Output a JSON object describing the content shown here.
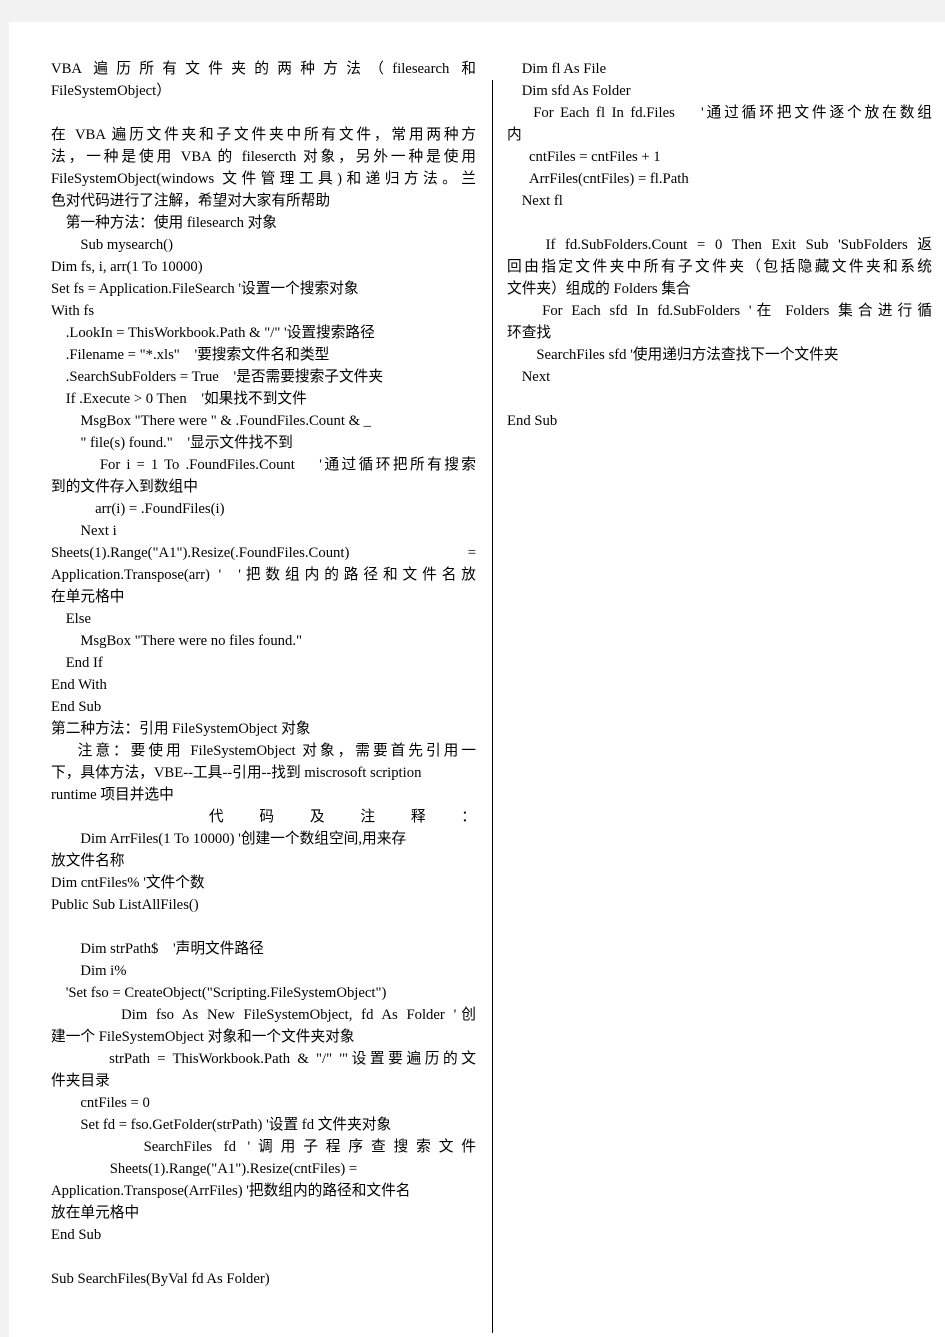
{
  "document": {
    "title": "VBA 遍历所有文件夹的两种方法（filesearch 和 FileSystemObject）",
    "page_background": "#ffffff",
    "surround_background": "#f2f2f2",
    "text_color": "#000000",
    "divider_color": "#000000"
  },
  "left_column": {
    "lines": [
      "VBA 遍历所有文件夹的两种方法（filesearch 和",
      "FileSystemObject）",
      "",
      "在 VBA 遍历文件夹和子文件夹中所有文件，常用两种方",
      "法，一种是使用 VBA 的 filesercth 对象，另外一种是使用",
      "FileSystemObject(windows 文件管理工具)和递归方法。兰",
      "色对代码进行了注解，希望对大家有所帮助",
      "    第一种方法：使用 filesearch 对象",
      "        Sub mysearch()",
      "Dim fs, i, arr(1 To 10000)",
      "Set fs = Application.FileSearch '设置一个搜索对象",
      "With fs",
      "    .LookIn = ThisWorkbook.Path & \"/\" '设置搜索路径",
      "    .Filename = \"*.xls\"    '要搜索文件名和类型",
      "    .SearchSubFolders = True    '是否需要搜索子文件夹",
      "    If .Execute > 0 Then    '如果找不到文件",
      "        MsgBox \"There were \" & .FoundFiles.Count & _",
      "        \" file(s) found.\"    '显示文件找不到",
      "        For i = 1 To .FoundFiles.Count    '通过循环把所有搜索",
      "到的文件存入到数组中",
      "            arr(i) = .FoundFiles(i)",
      "        Next i",
      "Sheets(1).Range(\"A1\").Resize(.FoundFiles.Count) =",
      "Application.Transpose(arr) '  '把数组内的路径和文件名放",
      "在单元格中",
      "    Else",
      "        MsgBox \"There were no files found.\"",
      "    End If",
      "End With",
      "End Sub",
      "第二种方法：引用 FileSystemObject 对象",
      "    注意：要使用 FileSystemObject 对象，需要首先引用一",
      "下，具体方法，VBE--工具--引用--找到 miscrosoft scription",
      "runtime 项目并选中",
      "    代码及注释：",
      "        Dim ArrFiles(1 To 10000) '创建一个数组空间,用来存",
      "放文件名称",
      "Dim cntFiles% '文件个数",
      "Public Sub ListAllFiles()",
      "",
      "        Dim strPath$    '声明文件路径",
      "        Dim i%",
      "    'Set fso = CreateObject(\"Scripting.FileSystemObject\")",
      "        Dim fso As New FileSystemObject, fd As Folder '创",
      "建一个 FileSystemObject 对象和一个文件夹对象",
      "        strPath = ThisWorkbook.Path & \"/\" '\"设置要遍历的文",
      "件夹目录",
      "        cntFiles = 0",
      "        Set fd = fso.GetFolder(strPath) '设置 fd 文件夹对象",
      "        SearchFiles fd '调用子程序查搜索文件",
      "                Sheets(1).Range(\"A1\").Resize(cntFiles) =",
      "Application.Transpose(ArrFiles) '把数组内的路径和文件名",
      "放在单元格中",
      "End Sub",
      "",
      "Sub SearchFiles(ByVal fd As Folder)"
    ]
  },
  "right_column": {
    "lines": [
      "    Dim fl As File",
      "    Dim sfd As Folder",
      "    For Each fl In fd.Files    '通过循环把文件逐个放在数组",
      "内",
      "      cntFiles = cntFiles + 1",
      "      ArrFiles(cntFiles) = fl.Path",
      "    Next fl",
      "",
      "    If fd.SubFolders.Count = 0 Then Exit Sub 'SubFolders 返",
      "回由指定文件夹中所有子文件夹（包括隐藏文件夹和系统",
      "文件夹）组成的 Folders 集合",
      "    For Each sfd In fd.SubFolders '在 Folders 集合进行循",
      "环查找",
      "        SearchFiles sfd '使用递归方法查找下一个文件夹",
      "    Next",
      "",
      "End Sub"
    ]
  }
}
